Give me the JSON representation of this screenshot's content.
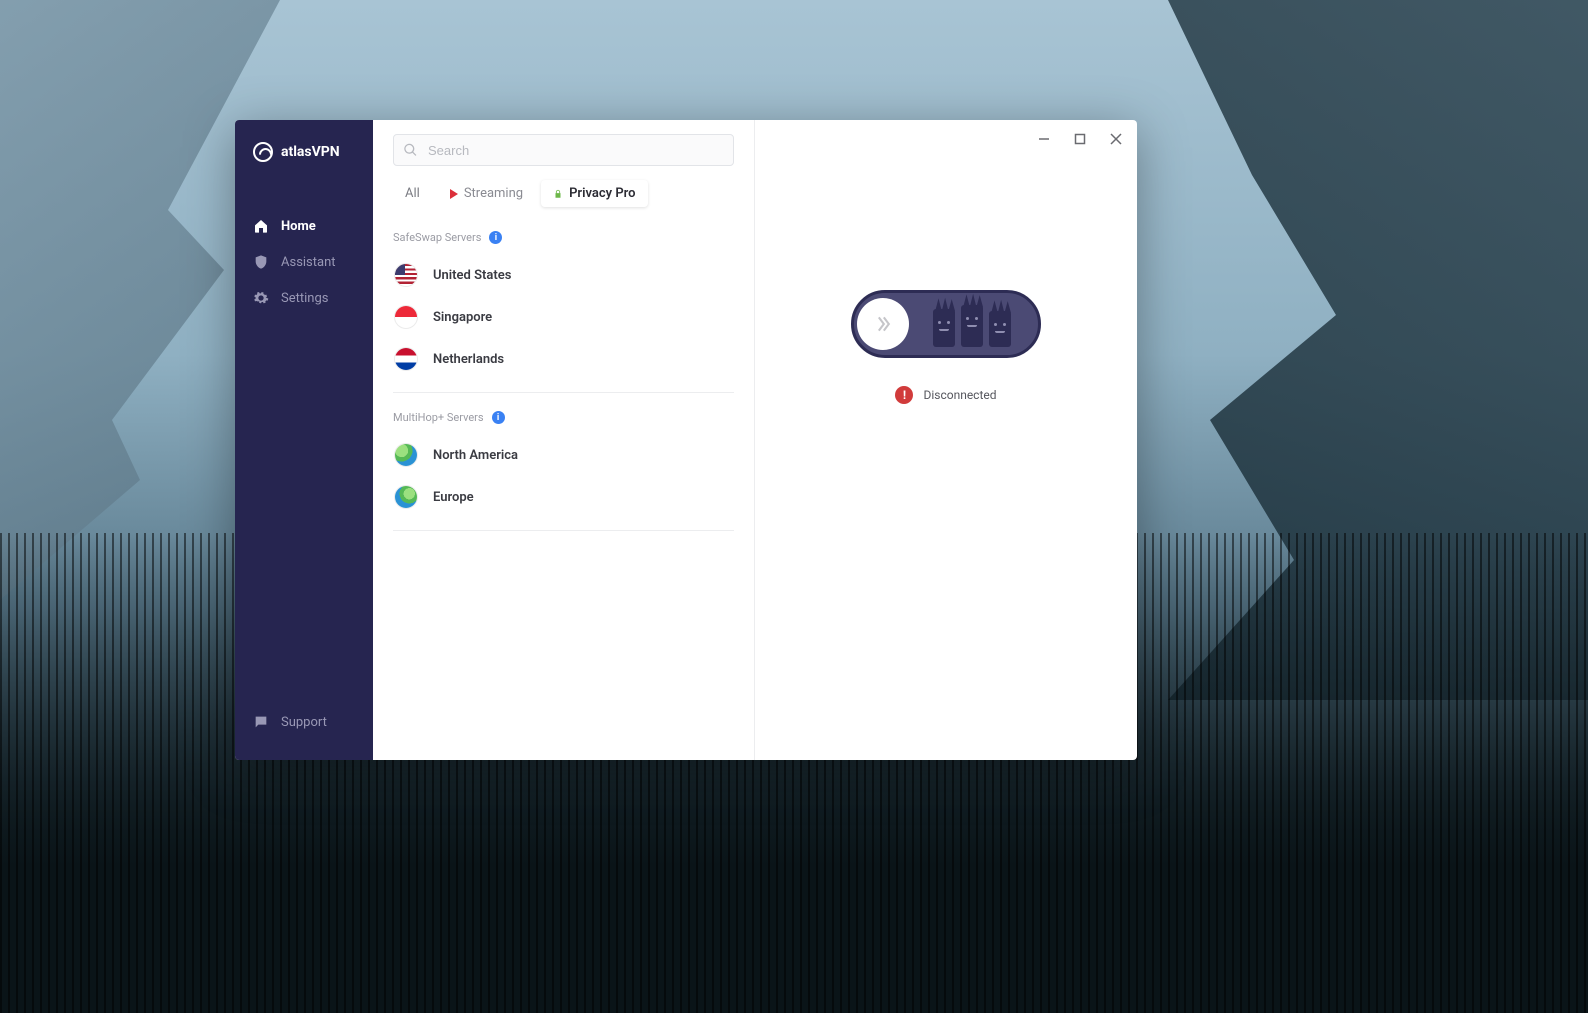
{
  "app": {
    "name": "atlasVPN"
  },
  "sidebar": {
    "items": [
      {
        "id": "home",
        "label": "Home",
        "active": true
      },
      {
        "id": "assistant",
        "label": "Assistant",
        "active": false
      },
      {
        "id": "settings",
        "label": "Settings",
        "active": false
      }
    ],
    "support_label": "Support"
  },
  "search": {
    "placeholder": "Search",
    "value": ""
  },
  "tabs": [
    {
      "id": "all",
      "label": "All",
      "active": false
    },
    {
      "id": "streaming",
      "label": "Streaming",
      "active": false
    },
    {
      "id": "privacy",
      "label": "Privacy Pro",
      "active": true
    }
  ],
  "sections": {
    "safeswap": {
      "title": "SafeSwap Servers",
      "servers": [
        {
          "id": "us",
          "label": "United States"
        },
        {
          "id": "sg",
          "label": "Singapore"
        },
        {
          "id": "nl",
          "label": "Netherlands"
        }
      ]
    },
    "multihop": {
      "title": "MultiHop+ Servers",
      "servers": [
        {
          "id": "na",
          "label": "North America"
        },
        {
          "id": "eu",
          "label": "Europe"
        }
      ]
    }
  },
  "connection": {
    "status_label": "Disconnected",
    "connected": false
  },
  "info_badge": "i",
  "status_badge": "!",
  "colors": {
    "sidebar_bg": "#262550",
    "accent_blue": "#3a81f3",
    "danger": "#d13b3b",
    "streaming_red": "#dc2f3a",
    "privacy_green": "#6eb84a"
  }
}
